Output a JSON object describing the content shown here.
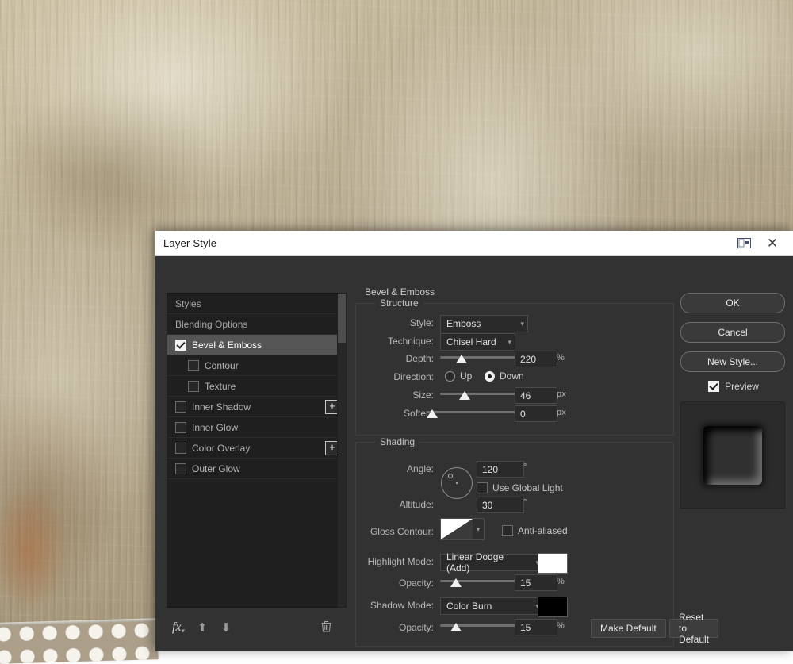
{
  "window": {
    "title": "Layer Style",
    "dock_icon": "panel-dock-icon",
    "close_icon": "close-icon"
  },
  "styles_list": {
    "items": [
      {
        "label": "Styles",
        "checkbox": "none",
        "indent": false,
        "selected": false,
        "plus": false
      },
      {
        "label": "Blending Options",
        "checkbox": "none",
        "indent": false,
        "selected": false,
        "plus": false
      },
      {
        "label": "Bevel & Emboss",
        "checkbox": "on",
        "indent": false,
        "selected": true,
        "plus": false
      },
      {
        "label": "Contour",
        "checkbox": "off",
        "indent": true,
        "selected": false,
        "plus": false
      },
      {
        "label": "Texture",
        "checkbox": "off",
        "indent": true,
        "selected": false,
        "plus": false
      },
      {
        "label": "Inner Shadow",
        "checkbox": "off",
        "indent": false,
        "selected": false,
        "plus": true
      },
      {
        "label": "Inner Glow",
        "checkbox": "off",
        "indent": false,
        "selected": false,
        "plus": false
      },
      {
        "label": "Color Overlay",
        "checkbox": "off",
        "indent": false,
        "selected": false,
        "plus": true
      },
      {
        "label": "Outer Glow",
        "checkbox": "off",
        "indent": false,
        "selected": false,
        "plus": false
      }
    ],
    "toolbar": {
      "fx": "fx",
      "move_up_icon": "arrow-up-icon",
      "move_down_icon": "arrow-down-icon",
      "delete_icon": "trash-icon"
    }
  },
  "panel": {
    "title": "Bevel & Emboss",
    "structure": {
      "legend": "Structure",
      "style": {
        "label": "Style:",
        "value": "Emboss"
      },
      "technique": {
        "label": "Technique:",
        "value": "Chisel Hard"
      },
      "depth": {
        "label": "Depth:",
        "value": "220",
        "unit": "%",
        "percent": 24
      },
      "direction": {
        "label": "Direction:",
        "up": "Up",
        "down": "Down",
        "selected": "Down"
      },
      "size": {
        "label": "Size:",
        "value": "46",
        "unit": "px",
        "percent": 28
      },
      "soften": {
        "label": "Soften:",
        "value": "0",
        "unit": "px",
        "percent": 0
      }
    },
    "shading": {
      "legend": "Shading",
      "angle": {
        "label": "Angle:",
        "value": "120",
        "unit": "°"
      },
      "use_global_light": {
        "label": "Use Global Light",
        "checked": false
      },
      "altitude": {
        "label": "Altitude:",
        "value": "30",
        "unit": "°"
      },
      "gloss_contour": {
        "label": "Gloss Contour:",
        "preset": "linear-ramp"
      },
      "anti_aliased": {
        "label": "Anti-aliased",
        "checked": false
      },
      "highlight_mode": {
        "label": "Highlight Mode:",
        "value": "Linear Dodge (Add)",
        "color": "#ffffff"
      },
      "highlight_opacity": {
        "label": "Opacity:",
        "value": "15",
        "unit": "%",
        "percent": 15
      },
      "shadow_mode": {
        "label": "Shadow Mode:",
        "value": "Color Burn",
        "color": "#000000"
      },
      "shadow_opacity": {
        "label": "Opacity:",
        "value": "15",
        "unit": "%",
        "percent": 15
      }
    },
    "footer": {
      "make_default": "Make Default",
      "reset_to_default": "Reset to Default"
    }
  },
  "actions": {
    "ok": "OK",
    "cancel": "Cancel",
    "new_style": "New Style...",
    "preview": {
      "label": "Preview",
      "checked": true
    }
  }
}
